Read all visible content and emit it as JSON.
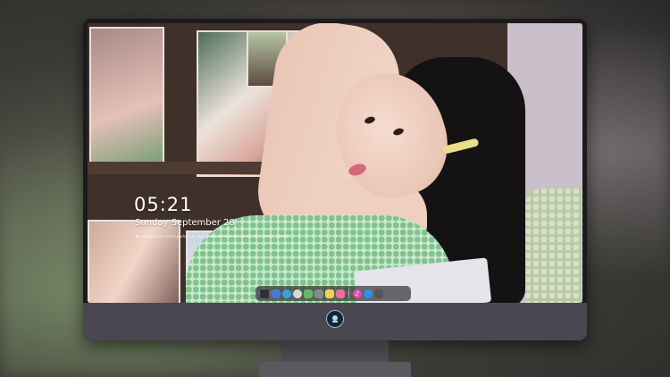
{
  "lockscreen": {
    "time": "05:21",
    "date": "Sunday September 28",
    "quote": "Be who you are and say what you feel, because those who mind don't matter 保持本色"
  },
  "dock": {
    "apps": [
      {
        "name": "finder",
        "glyph": "",
        "color": "#2f2f35"
      },
      {
        "name": "launchpad",
        "glyph": "",
        "color": "#4b79d8"
      },
      {
        "name": "messages",
        "glyph": "",
        "color": "#3d9de0"
      },
      {
        "name": "safari",
        "glyph": "",
        "color": "#d9d9d9"
      },
      {
        "name": "maps",
        "glyph": "",
        "color": "#63b86a"
      },
      {
        "name": "movies",
        "glyph": "",
        "color": "#8a8a8a"
      },
      {
        "name": "notes",
        "glyph": "",
        "color": "#f2d350"
      },
      {
        "name": "photos",
        "glyph": "",
        "color": "#ea6f9b"
      },
      {
        "name": "music",
        "glyph": "♪",
        "color": "#e64bb2"
      },
      {
        "name": "app-store",
        "glyph": "",
        "color": "#2c8ff2"
      },
      {
        "name": "camera",
        "glyph": "",
        "color": "#555556"
      }
    ]
  }
}
